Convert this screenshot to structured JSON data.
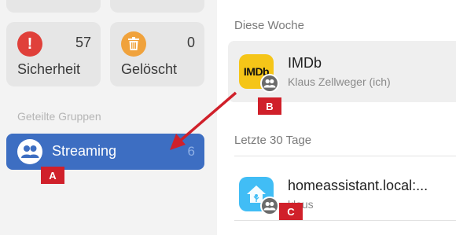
{
  "sidebar": {
    "tiles": [
      {
        "label": "Sicherheit",
        "count": "57",
        "icon": "exclamation-icon",
        "color": "#e0403a",
        "glyph": "!"
      },
      {
        "label": "Gelöscht",
        "count": "0",
        "icon": "trash-icon",
        "color": "#f0a23c"
      }
    ],
    "section_label": "Geteilte Gruppen",
    "group": {
      "label": "Streaming",
      "count": "6",
      "icon": "people-icon"
    }
  },
  "list": {
    "sections": [
      {
        "label": "Diese Woche"
      },
      {
        "label": "Letzte 30 Tage"
      }
    ],
    "items": [
      {
        "title": "IMDb",
        "subtitle": "Klaus Zellweger (ich)",
        "icon_text": "IMDb",
        "icon": "imdb-icon"
      },
      {
        "title": "homeassistant.local:...",
        "subtitle": "klaus",
        "icon": "home-assistant-icon"
      }
    ]
  },
  "annotations": {
    "markers": [
      "A",
      "B",
      "C"
    ],
    "color": "#d0202a"
  }
}
